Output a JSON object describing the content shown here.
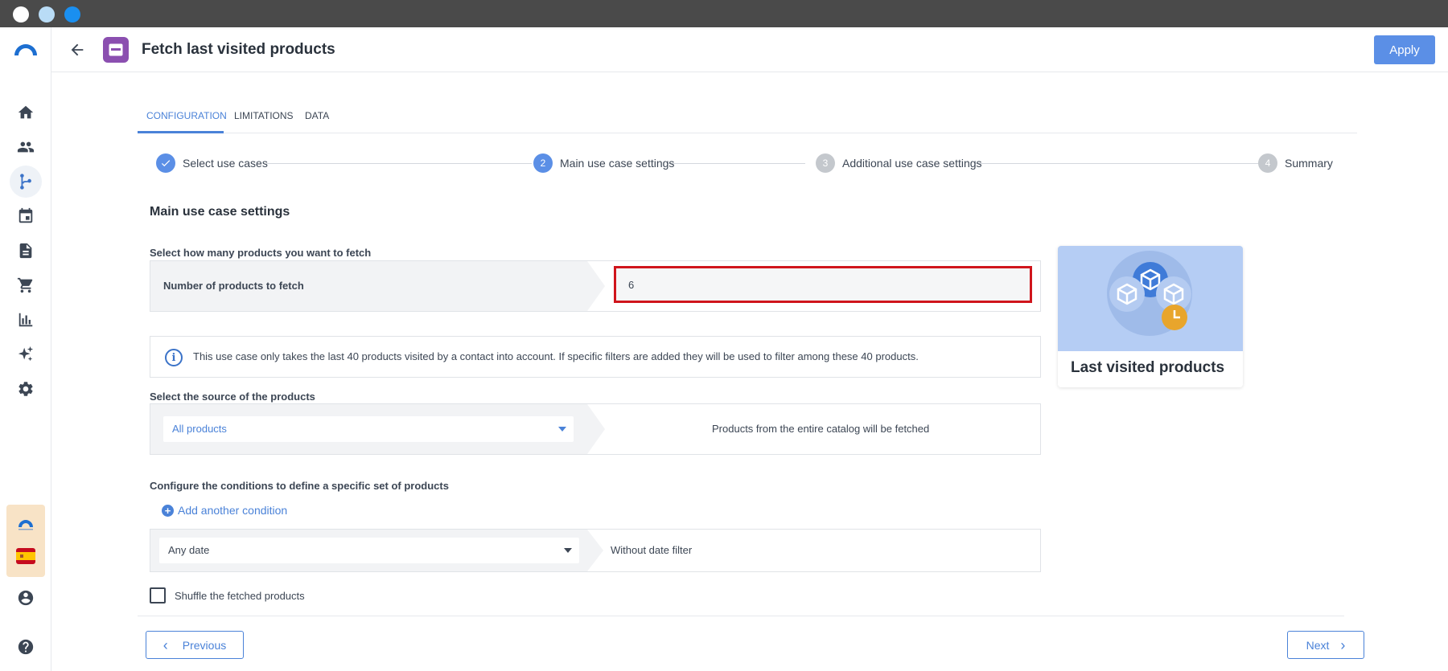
{
  "window": {
    "traffic_lights": [
      "close",
      "minimize",
      "maximize"
    ]
  },
  "sidebar": {
    "items": [
      {
        "name": "home",
        "icon": "home-icon"
      },
      {
        "name": "contacts",
        "icon": "people-icon"
      },
      {
        "name": "automation",
        "icon": "flow-icon",
        "active": true
      },
      {
        "name": "calendar",
        "icon": "calendar-icon"
      },
      {
        "name": "content",
        "icon": "document-icon"
      },
      {
        "name": "ecommerce",
        "icon": "cart-icon"
      },
      {
        "name": "analytics",
        "icon": "chart-icon"
      },
      {
        "name": "ai",
        "icon": "sparkles-icon"
      },
      {
        "name": "settings",
        "icon": "gear-icon"
      }
    ],
    "bottom": {
      "account_icon": "account-icon",
      "help_icon": "help-icon"
    }
  },
  "header": {
    "title": "Fetch last visited products",
    "apply_label": "Apply"
  },
  "tabs": [
    {
      "label": "CONFIGURATION",
      "active": true
    },
    {
      "label": "LIMITATIONS",
      "active": false
    },
    {
      "label": "DATA",
      "active": false
    }
  ],
  "stepper": {
    "steps": [
      {
        "number": "1",
        "label": "Select use cases",
        "state": "done"
      },
      {
        "number": "2",
        "label": "Main use case settings",
        "state": "current"
      },
      {
        "number": "3",
        "label": "Additional use case settings",
        "state": "todo"
      },
      {
        "number": "4",
        "label": "Summary",
        "state": "todo"
      }
    ]
  },
  "main": {
    "section_title": "Main use case settings",
    "products_count": {
      "label": "Select how many products you want to fetch",
      "field_label": "Number of products to fetch",
      "value": "6"
    },
    "info_text": "This use case only takes the last 40 products visited by a contact into account. If specific filters are added they will be used to filter among these 40 products.",
    "source": {
      "label": "Select the source of the products",
      "selected": "All products",
      "description": "Products from the entire catalog will be fetched"
    },
    "conditions": {
      "label": "Configure the conditions to define a specific set of products",
      "add_label": "Add another condition",
      "date_selected": "Any date",
      "date_description": "Without date filter"
    },
    "shuffle_label": "Shuffle the fetched products"
  },
  "card": {
    "title": "Last visited products"
  },
  "footer": {
    "previous_label": "Previous",
    "next_label": "Next"
  },
  "colors": {
    "accent": "#5b8fe6",
    "highlight": "#d0151c",
    "use_case_icon": "#8b4fb0"
  }
}
